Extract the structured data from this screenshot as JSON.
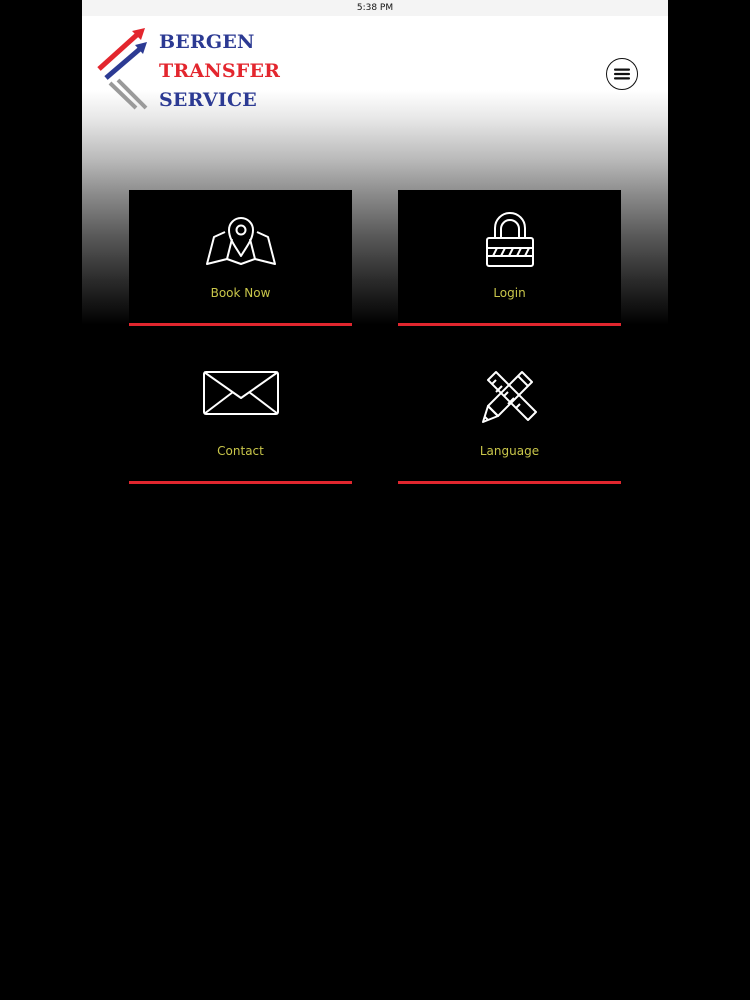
{
  "status_bar": {
    "time": "5:38 PM"
  },
  "logo": {
    "line1": "BERGEN",
    "line2": "TRANSFER",
    "line3": "SERVICE",
    "colors": {
      "blue": "#2c3a93",
      "red": "#e3262e",
      "gray": "#9a9a9a"
    }
  },
  "header": {
    "menu_icon": "hamburger-icon"
  },
  "tiles": [
    {
      "label": "Book Now",
      "icon": "map-pin-icon"
    },
    {
      "label": "Login",
      "icon": "lock-icon"
    },
    {
      "label": "Contact",
      "icon": "envelope-icon"
    },
    {
      "label": "Language",
      "icon": "pencil-ruler-icon"
    }
  ],
  "colors": {
    "background": "#000000",
    "accent": "#e0262e",
    "label": "#c9c64a"
  }
}
